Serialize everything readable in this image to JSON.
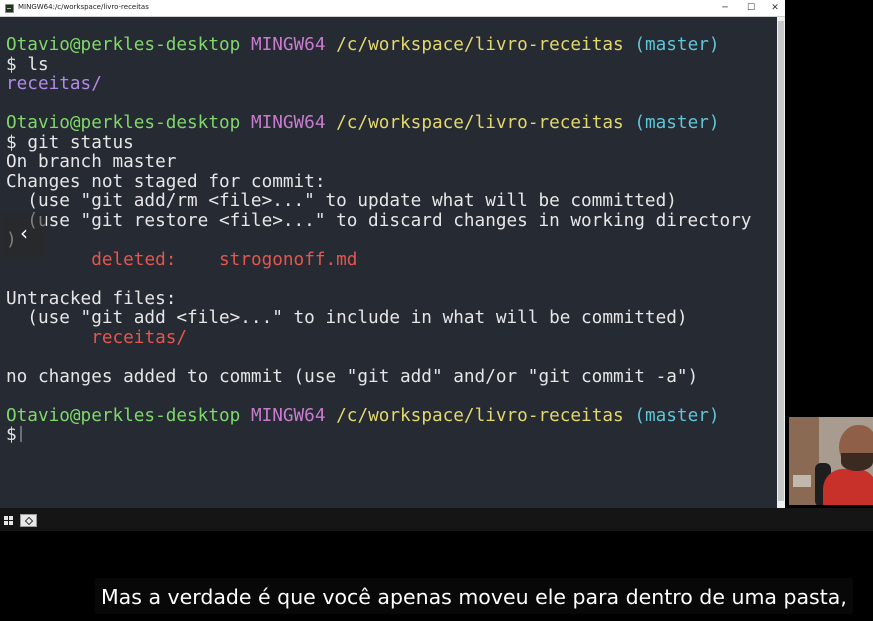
{
  "window": {
    "title": "MINGW64:/c/workspace/livro-receitas",
    "minimize_glyph": "─",
    "maximize_glyph": "☐",
    "close_glyph": "✕"
  },
  "terminal": {
    "prompt": {
      "user_host": "Otavio@perkles-desktop",
      "shell": "MINGW64",
      "path": "/c/workspace/livro-receitas",
      "branch": "(master)",
      "symbol": "$"
    },
    "cmd_ls": "ls",
    "ls_output": "receitas/",
    "cmd_status": "git status",
    "status": {
      "on_branch": "On branch master",
      "not_staged_header": "Changes not staged for commit:",
      "hint_add_rm": "  (use \"git add/rm <file>...\" to update what will be committed)",
      "hint_restore": "  (use \"git restore <file>...\" to discard changes in working directory",
      "hint_cut": ")",
      "deleted_label": "deleted:",
      "deleted_file": "strogonoff.md",
      "untracked_header": "Untracked files:",
      "hint_include": "  (use \"git add <file>...\" to include in what will be committed)",
      "untracked_file": "receitas/",
      "footer": "no changes added to commit (use \"git add\" and/or \"git commit -a\")"
    }
  },
  "overlay": {
    "back_arrow": "‹"
  },
  "taskbar": {
    "start_icon": "windows-logo",
    "app_icon": "git-bash"
  },
  "caption": {
    "text": "Mas a verdade é que você apenas moveu ele para dentro de uma pasta,"
  },
  "colors": {
    "terminal_bg": "#262a33",
    "user_host": "#7fd86a",
    "shell": "#c97bd0",
    "path": "#e3d86a",
    "branch": "#5fc6d8",
    "deleted": "#e4564e",
    "directory": "#b18ae6"
  }
}
